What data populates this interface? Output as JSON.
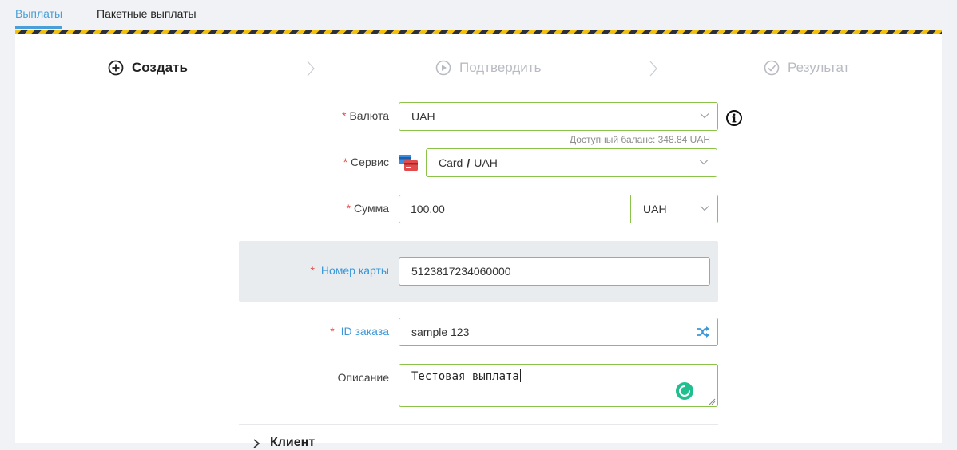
{
  "tabs": [
    {
      "label": "Выплаты",
      "active": true
    },
    {
      "label": "Пакетные выплаты",
      "active": false
    }
  ],
  "steps": [
    {
      "label": "Создать",
      "icon": "plus-circle-icon",
      "state": "active"
    },
    {
      "label": "Подтвердить",
      "icon": "play-circle-icon",
      "state": "inactive"
    },
    {
      "label": "Результат",
      "icon": "check-circle-icon",
      "state": "inactive"
    }
  ],
  "form": {
    "currency": {
      "label": "Валюта",
      "value": "UAH",
      "balance_hint": "Доступный баланс: 348.84 UAH"
    },
    "service": {
      "label": "Сервис",
      "method": "Card",
      "separator": "/",
      "currency": "UAH"
    },
    "amount": {
      "label": "Сумма",
      "value": "100.00",
      "currency": "UAH"
    },
    "card_number": {
      "label": "Номер карты",
      "value": "5123817234060000"
    },
    "order_id": {
      "label": "ID заказа",
      "value": "sample 123"
    },
    "description": {
      "label": "Описание",
      "value": "Тестовая выплата"
    }
  },
  "client_section": {
    "title": "Клиент"
  },
  "colors": {
    "accent": "#4a9fd8",
    "field_border": "#8bc34a",
    "required": "#e94b4b",
    "spinner": "#1fbf8f"
  }
}
